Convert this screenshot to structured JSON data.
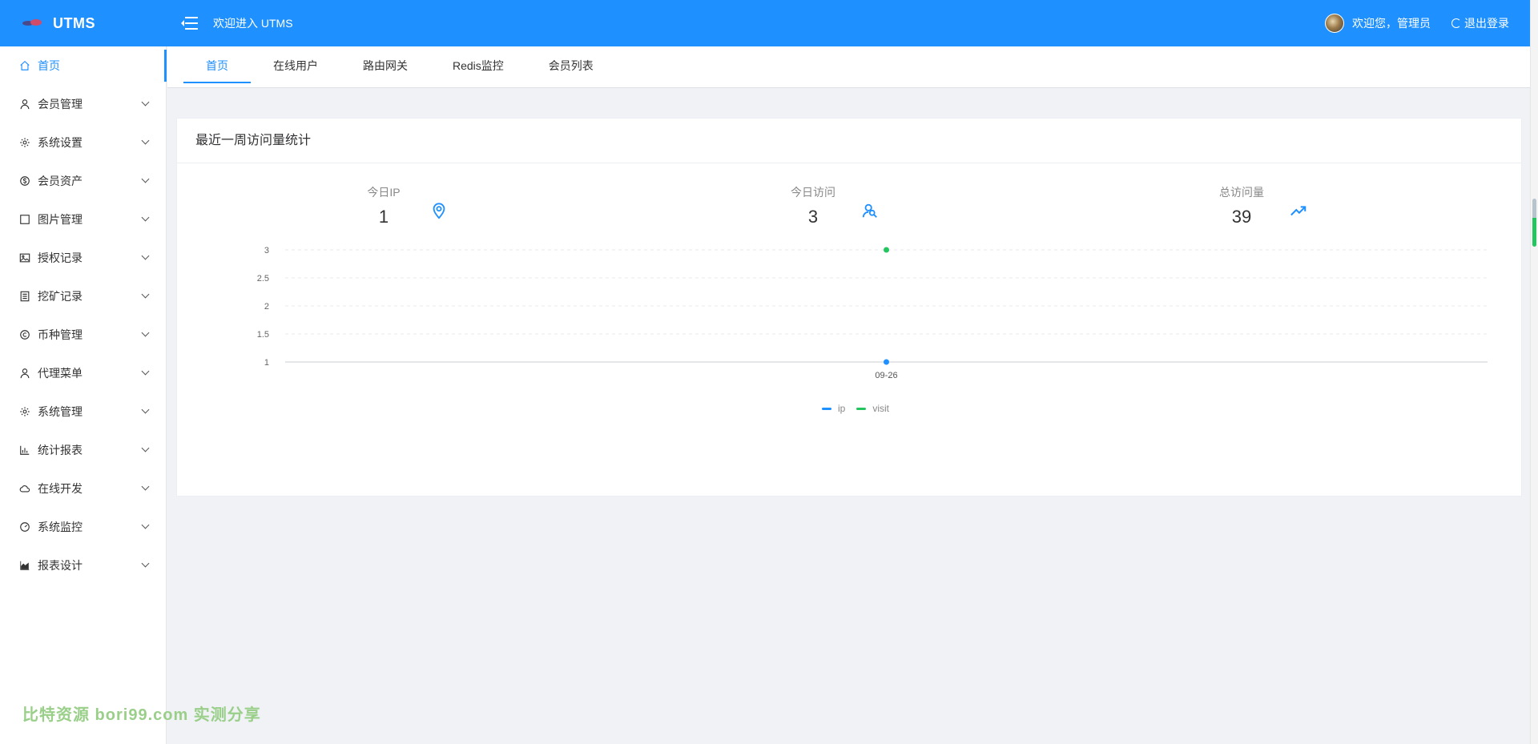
{
  "app": {
    "name": "UTMS",
    "welcome_banner": "欢迎进入 UTMS"
  },
  "user": {
    "greeting": "欢迎您，管理员",
    "logout_label": "退出登录"
  },
  "sidebar": {
    "items": [
      {
        "label": "首页",
        "icon": "home-icon",
        "active": true,
        "has_children": false
      },
      {
        "label": "会员管理",
        "icon": "user-icon",
        "has_children": true
      },
      {
        "label": "系统设置",
        "icon": "gear-icon",
        "has_children": true
      },
      {
        "label": "会员资产",
        "icon": "coin-icon",
        "has_children": true
      },
      {
        "label": "图片管理",
        "icon": "square-icon",
        "has_children": true
      },
      {
        "label": "授权记录",
        "icon": "picture-icon",
        "has_children": true
      },
      {
        "label": "挖矿记录",
        "icon": "list-icon",
        "has_children": true
      },
      {
        "label": "币种管理",
        "icon": "copyright-icon",
        "has_children": true
      },
      {
        "label": "代理菜单",
        "icon": "user-icon",
        "has_children": true
      },
      {
        "label": "系统管理",
        "icon": "gear-icon",
        "has_children": true
      },
      {
        "label": "统计报表",
        "icon": "bar-chart-icon",
        "has_children": true
      },
      {
        "label": "在线开发",
        "icon": "cloud-icon",
        "has_children": true
      },
      {
        "label": "系统监控",
        "icon": "gauge-icon",
        "has_children": true
      },
      {
        "label": "报表设计",
        "icon": "area-chart-icon",
        "has_children": true
      }
    ]
  },
  "tabs": [
    {
      "label": "首页",
      "active": true
    },
    {
      "label": "在线用户"
    },
    {
      "label": "路由网关"
    },
    {
      "label": "Redis监控"
    },
    {
      "label": "会员列表"
    }
  ],
  "card": {
    "title": "最近一周访问量统计"
  },
  "stats": [
    {
      "label": "今日IP",
      "value": "1",
      "icon": "location-pin-icon"
    },
    {
      "label": "今日访问",
      "value": "3",
      "icon": "users-icon"
    },
    {
      "label": "总访问量",
      "value": "39",
      "icon": "trend-up-icon"
    }
  ],
  "chart_data": {
    "type": "scatter",
    "x": [
      "09-26"
    ],
    "series": [
      {
        "name": "ip",
        "values": [
          1
        ],
        "color": "#1e90ff"
      },
      {
        "name": "visit",
        "values": [
          3
        ],
        "color": "#22c55e"
      }
    ],
    "yticks": [
      "1",
      "1.5",
      "2",
      "2.5",
      "3"
    ],
    "ylim": [
      1,
      3
    ],
    "grid": true,
    "legend": "bottom-center"
  },
  "colors": {
    "primary": "#1e90ff",
    "visit": "#22c55e",
    "background": "#f0f2f5"
  },
  "watermark": "比特资源 bori99.com 实测分享"
}
